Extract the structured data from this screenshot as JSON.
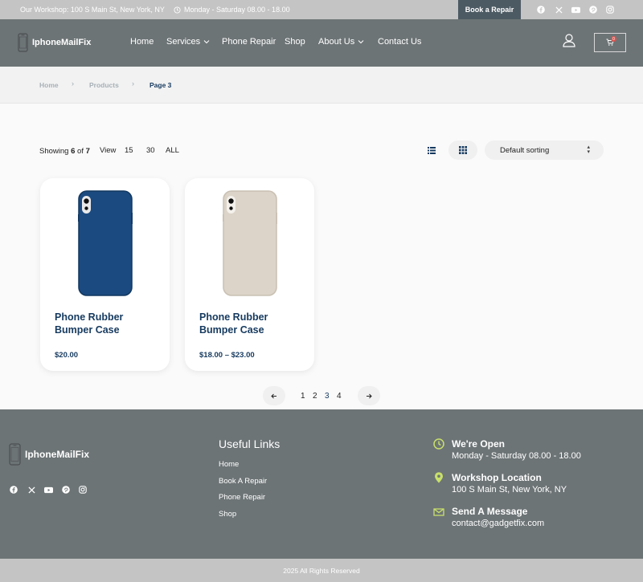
{
  "topbar": {
    "workshop": "Our Workshop: 100 S Main St, New York, NY",
    "hours": "Monday - Saturday 08.00 - 18.00",
    "book_button": "Book a Repair",
    "socials": [
      "facebook-icon",
      "x-icon",
      "youtube-icon",
      "pinterest-icon",
      "instagram-icon"
    ]
  },
  "header": {
    "logo": "IphoneMailFix",
    "nav": [
      {
        "label": "Home"
      },
      {
        "label": "Services"
      },
      {
        "label": "Phone Repair"
      },
      {
        "label": "Shop"
      },
      {
        "label": "About Us"
      },
      {
        "label": "Contact Us"
      }
    ],
    "cart_count": "0"
  },
  "breadcrumb": {
    "items": [
      "Home",
      "Products",
      "Page 3"
    ]
  },
  "toolbar": {
    "showing_prefix": "Showing",
    "showing_count": "6",
    "showing_of": "of",
    "showing_total": "7",
    "view_label": "View",
    "view_options": [
      "15",
      "30",
      "ALL"
    ],
    "sort_value": "Default sorting"
  },
  "products": [
    {
      "title": "Phone Rubber Bumper Case",
      "price": "$20.00",
      "color": "#1b4a80"
    },
    {
      "title": "Phone Rubber Bumper Case",
      "price": "$18.00 – $23.00",
      "color": "#dcd4c8"
    }
  ],
  "pagination": {
    "pages": [
      "1",
      "2",
      "3",
      "4"
    ],
    "current": "3"
  },
  "footer": {
    "logo": "IphoneMailFix",
    "useful_title": "Useful Links",
    "useful_links": [
      "Home",
      "Book A Repair",
      "Phone Repair",
      "Shop"
    ],
    "contact": [
      {
        "title": "We're Open",
        "value": "Monday - Saturday 08.00 - 18.00",
        "icon": "clock-icon"
      },
      {
        "title": "Workshop Location",
        "value": "100 S Main St, New York, NY",
        "icon": "location-pin-icon"
      },
      {
        "title": "Send A Message",
        "value": "contact@gadgetfix.com",
        "icon": "mail-icon"
      }
    ],
    "copyright": "2025 All Rights Reserved"
  },
  "colors": {
    "accent": "#4c5a63",
    "header_bg": "#6d7476",
    "product_title": "#163a5f",
    "footer_icon": "#c8e06a"
  }
}
